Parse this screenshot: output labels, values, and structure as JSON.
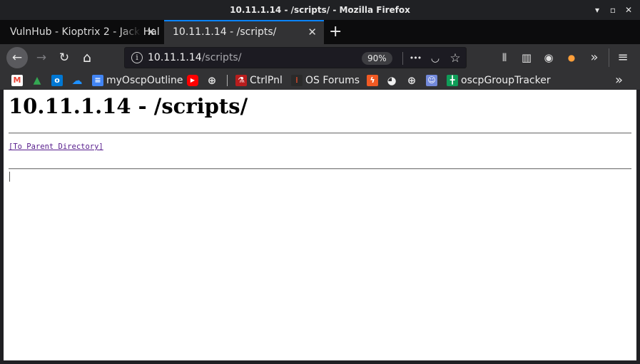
{
  "window": {
    "title": "10.11.1.14 - /scripts/ - Mozilla Firefox",
    "minimize_glyph": "▾",
    "maximize_glyph": "▫",
    "close_glyph": "✕"
  },
  "tabs": [
    {
      "label": "VulnHub - Kioptrix 2 - Jack Hal",
      "active": false,
      "close_glyph": "✕"
    },
    {
      "label": "10.11.1.14 - /scripts/",
      "active": true,
      "close_glyph": "✕"
    }
  ],
  "new_tab_glyph": "+",
  "navbar": {
    "back_glyph": "←",
    "forward_glyph": "→",
    "reload_glyph": "↻",
    "home_glyph": "⌂",
    "url_host": "10.11.1.14",
    "url_path": "/scripts/",
    "info_glyph": "i",
    "zoom": "90%",
    "page_actions_glyph": "•••",
    "pocket_glyph": "◡",
    "star_glyph": "☆",
    "library_glyph": "⫴",
    "sidebar_glyph": "▥",
    "account_glyph": "◉",
    "addon_glyph": "●",
    "overflow_glyph": "»",
    "menu_glyph": "≡"
  },
  "bookmarks": [
    {
      "label": "",
      "icon": "gmail-icon",
      "glyph": "M",
      "color": "#ea4335"
    },
    {
      "label": "",
      "icon": "google-drive-icon",
      "glyph": "▲",
      "color": "#34a853"
    },
    {
      "label": "",
      "icon": "outlook-icon",
      "glyph": "o",
      "color": "#0078d4"
    },
    {
      "label": "",
      "icon": "onedrive-icon",
      "glyph": "☁",
      "color": "#0a6ed1"
    },
    {
      "label": "myOscpOutline",
      "icon": "google-docs-icon",
      "glyph": "≡",
      "color": "#4285f4"
    },
    {
      "label": "",
      "icon": "youtube-icon",
      "glyph": "▶",
      "color": "#ff0000"
    },
    {
      "label": "",
      "icon": "globe-icon",
      "glyph": "⊕",
      "color": "#323234"
    },
    {
      "label": "CtrlPnl",
      "icon": "ctrlpnl-icon",
      "glyph": "⚗",
      "color": "#b81d1d"
    },
    {
      "label": "OS Forums",
      "icon": "os-forums-icon",
      "glyph": "⁞",
      "color": "#2a2a2a"
    },
    {
      "label": "",
      "icon": "lightning-icon",
      "glyph": "ϟ",
      "color": "#f15a24"
    },
    {
      "label": "",
      "icon": "github-icon",
      "glyph": "◕",
      "color": "#323234"
    },
    {
      "label": "",
      "icon": "globe-icon-2",
      "glyph": "⊕",
      "color": "#323234"
    },
    {
      "label": "",
      "icon": "discord-icon",
      "glyph": "☺",
      "color": "#7289da"
    },
    {
      "label": "oscpGroupTracker",
      "icon": "google-sheets-icon",
      "glyph": "╋",
      "color": "#0f9d58"
    }
  ],
  "bookmarks_overflow_glyph": "»",
  "page": {
    "heading": "10.11.1.14 - /scripts/",
    "parent_link": "[To Parent Directory]"
  }
}
